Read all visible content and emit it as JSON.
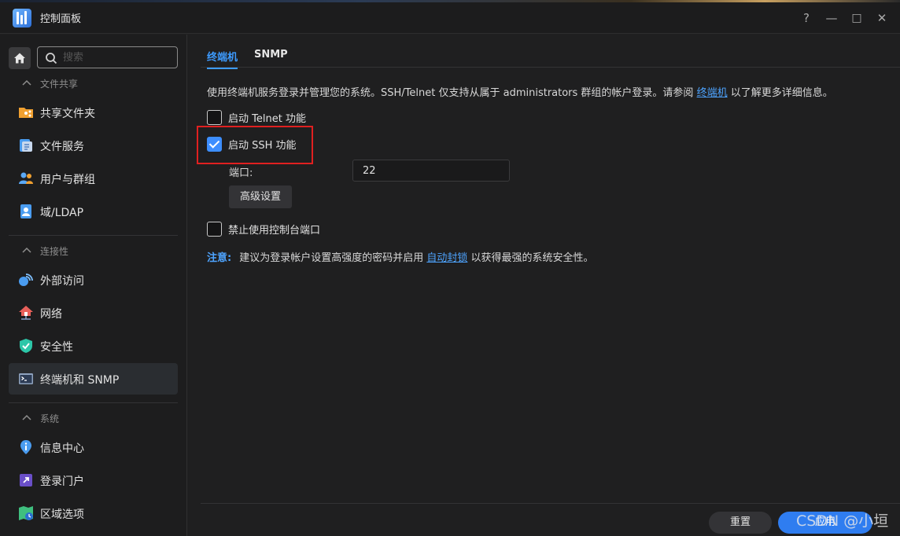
{
  "window": {
    "title": "控制面板",
    "help": "?",
    "minimize": "—",
    "maximize": "□",
    "close": "✕"
  },
  "sidebar": {
    "search_placeholder": "搜索",
    "sections": [
      {
        "label": "文件共享",
        "items": [
          "共享文件夹",
          "文件服务",
          "用户与群组",
          "域/LDAP"
        ]
      },
      {
        "label": "连接性",
        "items": [
          "外部访问",
          "网络",
          "安全性",
          "终端机和 SNMP"
        ]
      },
      {
        "label": "系统",
        "items": [
          "信息中心",
          "登录门户",
          "区域选项"
        ]
      }
    ],
    "active_item": "终端机和 SNMP"
  },
  "main": {
    "tabs": [
      {
        "label": "终端机",
        "active": true
      },
      {
        "label": "SNMP",
        "active": false
      }
    ],
    "description": {
      "before": "使用终端机服务登录并管理您的系统。SSH/Telnet 仅支持从属于 administrators 群组的帐户登录。请参阅 ",
      "link": "终端机",
      "after": " 以了解更多详细信息。"
    },
    "telnet": {
      "label": "启动 Telnet 功能",
      "checked": false
    },
    "ssh": {
      "label": "启动 SSH 功能",
      "checked": true
    },
    "port": {
      "label": "端口:",
      "value": "22"
    },
    "advanced_button": "高级设置",
    "console": {
      "label": "禁止使用控制台端口",
      "checked": false
    },
    "note": {
      "tag": "注意:",
      "before": "建议为登录帐户设置高强度的密码并启用 ",
      "link": "自动封锁",
      "after": " 以获得最强的系统安全性。"
    },
    "reset_button": "重置",
    "apply_button": "应用"
  },
  "watermark": "CSDN @小垣",
  "colors": {
    "accent": "#3d9bff",
    "highlight_box": "#e02020",
    "background": "#1f1f20"
  }
}
